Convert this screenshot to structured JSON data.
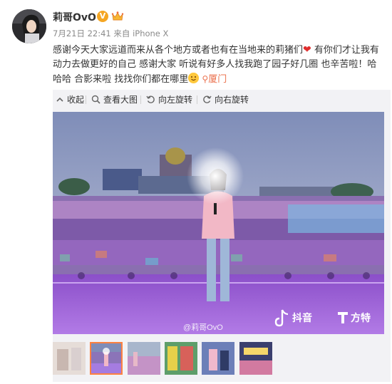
{
  "user": {
    "name": "莉哥OvO",
    "verified_badge": "V",
    "time": "7月21日 22:41",
    "source_prefix": "来自",
    "source": "iPhone X"
  },
  "post": {
    "line1_a": "感谢今天大家远道而来从各个地方或者也有在当地来的莉猪们",
    "line1_b": " 有你们才让我有",
    "line2": "动力去做更好的自己 感谢大家 听说有好多人找我跑了园子好几圈 也辛苦啦！哈",
    "line3": "哈哈 合影来啦 找找你们都在哪里",
    "location": "厦门"
  },
  "toolbar": {
    "collapse": "收起",
    "view_large": "查看大图",
    "rotate_left": "向左旋转",
    "rotate_right": "向右旋转"
  },
  "photo": {
    "watermark_weibo": "@莉哥OvO",
    "watermark_douyin": "抖音",
    "watermark_fangte": "方特"
  },
  "thumbnails": {
    "count": 6,
    "selected_index": 1
  },
  "colors": {
    "accent": "#eb7350",
    "selected_outline": "#ff8140",
    "meta_gray": "#8a8a8a",
    "toolbar_bg": "#f2f2f5"
  }
}
